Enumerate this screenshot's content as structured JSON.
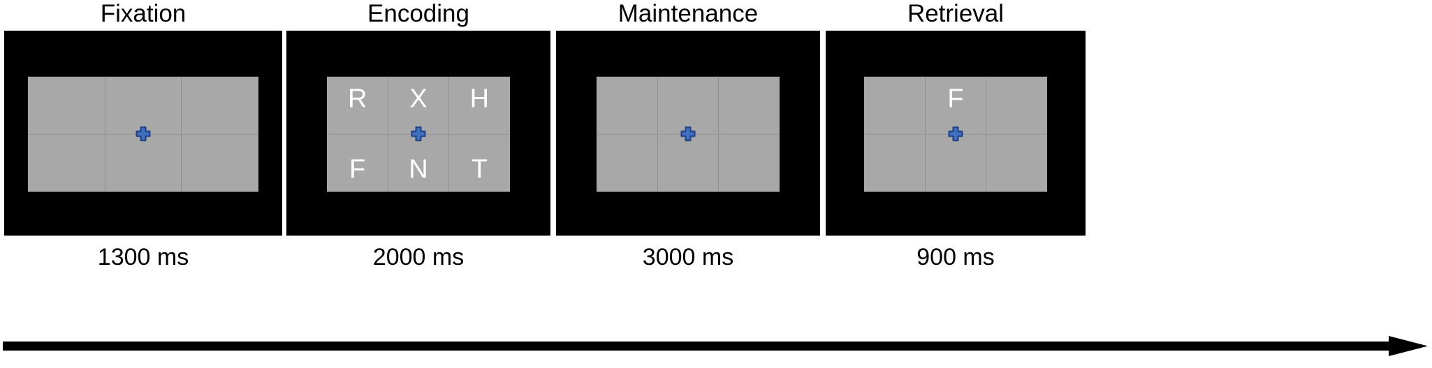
{
  "figure": {
    "background_color": "#ffffff",
    "screen_color": "#000000",
    "grid_color": "#a8a8a8",
    "gridline_color": "#8e8e8e",
    "letter_color": "#ffffff",
    "fixation_color": "#3f6fbf",
    "fixation_outline_color": "#1d3f86",
    "fixation_icon": "fixation-cross-icon",
    "arrow_icon": "time-arrow-icon"
  },
  "panels": [
    {
      "title": "Fixation",
      "duration": "1300 ms",
      "letters": [
        "",
        "",
        "",
        "",
        "",
        ""
      ]
    },
    {
      "title": "Encoding",
      "duration": "2000 ms",
      "letters": [
        "R",
        "X",
        "H",
        "F",
        "N",
        "T"
      ]
    },
    {
      "title": "Maintenance",
      "duration": "3000 ms",
      "letters": [
        "",
        "",
        "",
        "",
        "",
        ""
      ]
    },
    {
      "title": "Retrieval",
      "duration": "900 ms",
      "letters": [
        "",
        "F",
        "",
        "",
        "",
        ""
      ]
    }
  ]
}
